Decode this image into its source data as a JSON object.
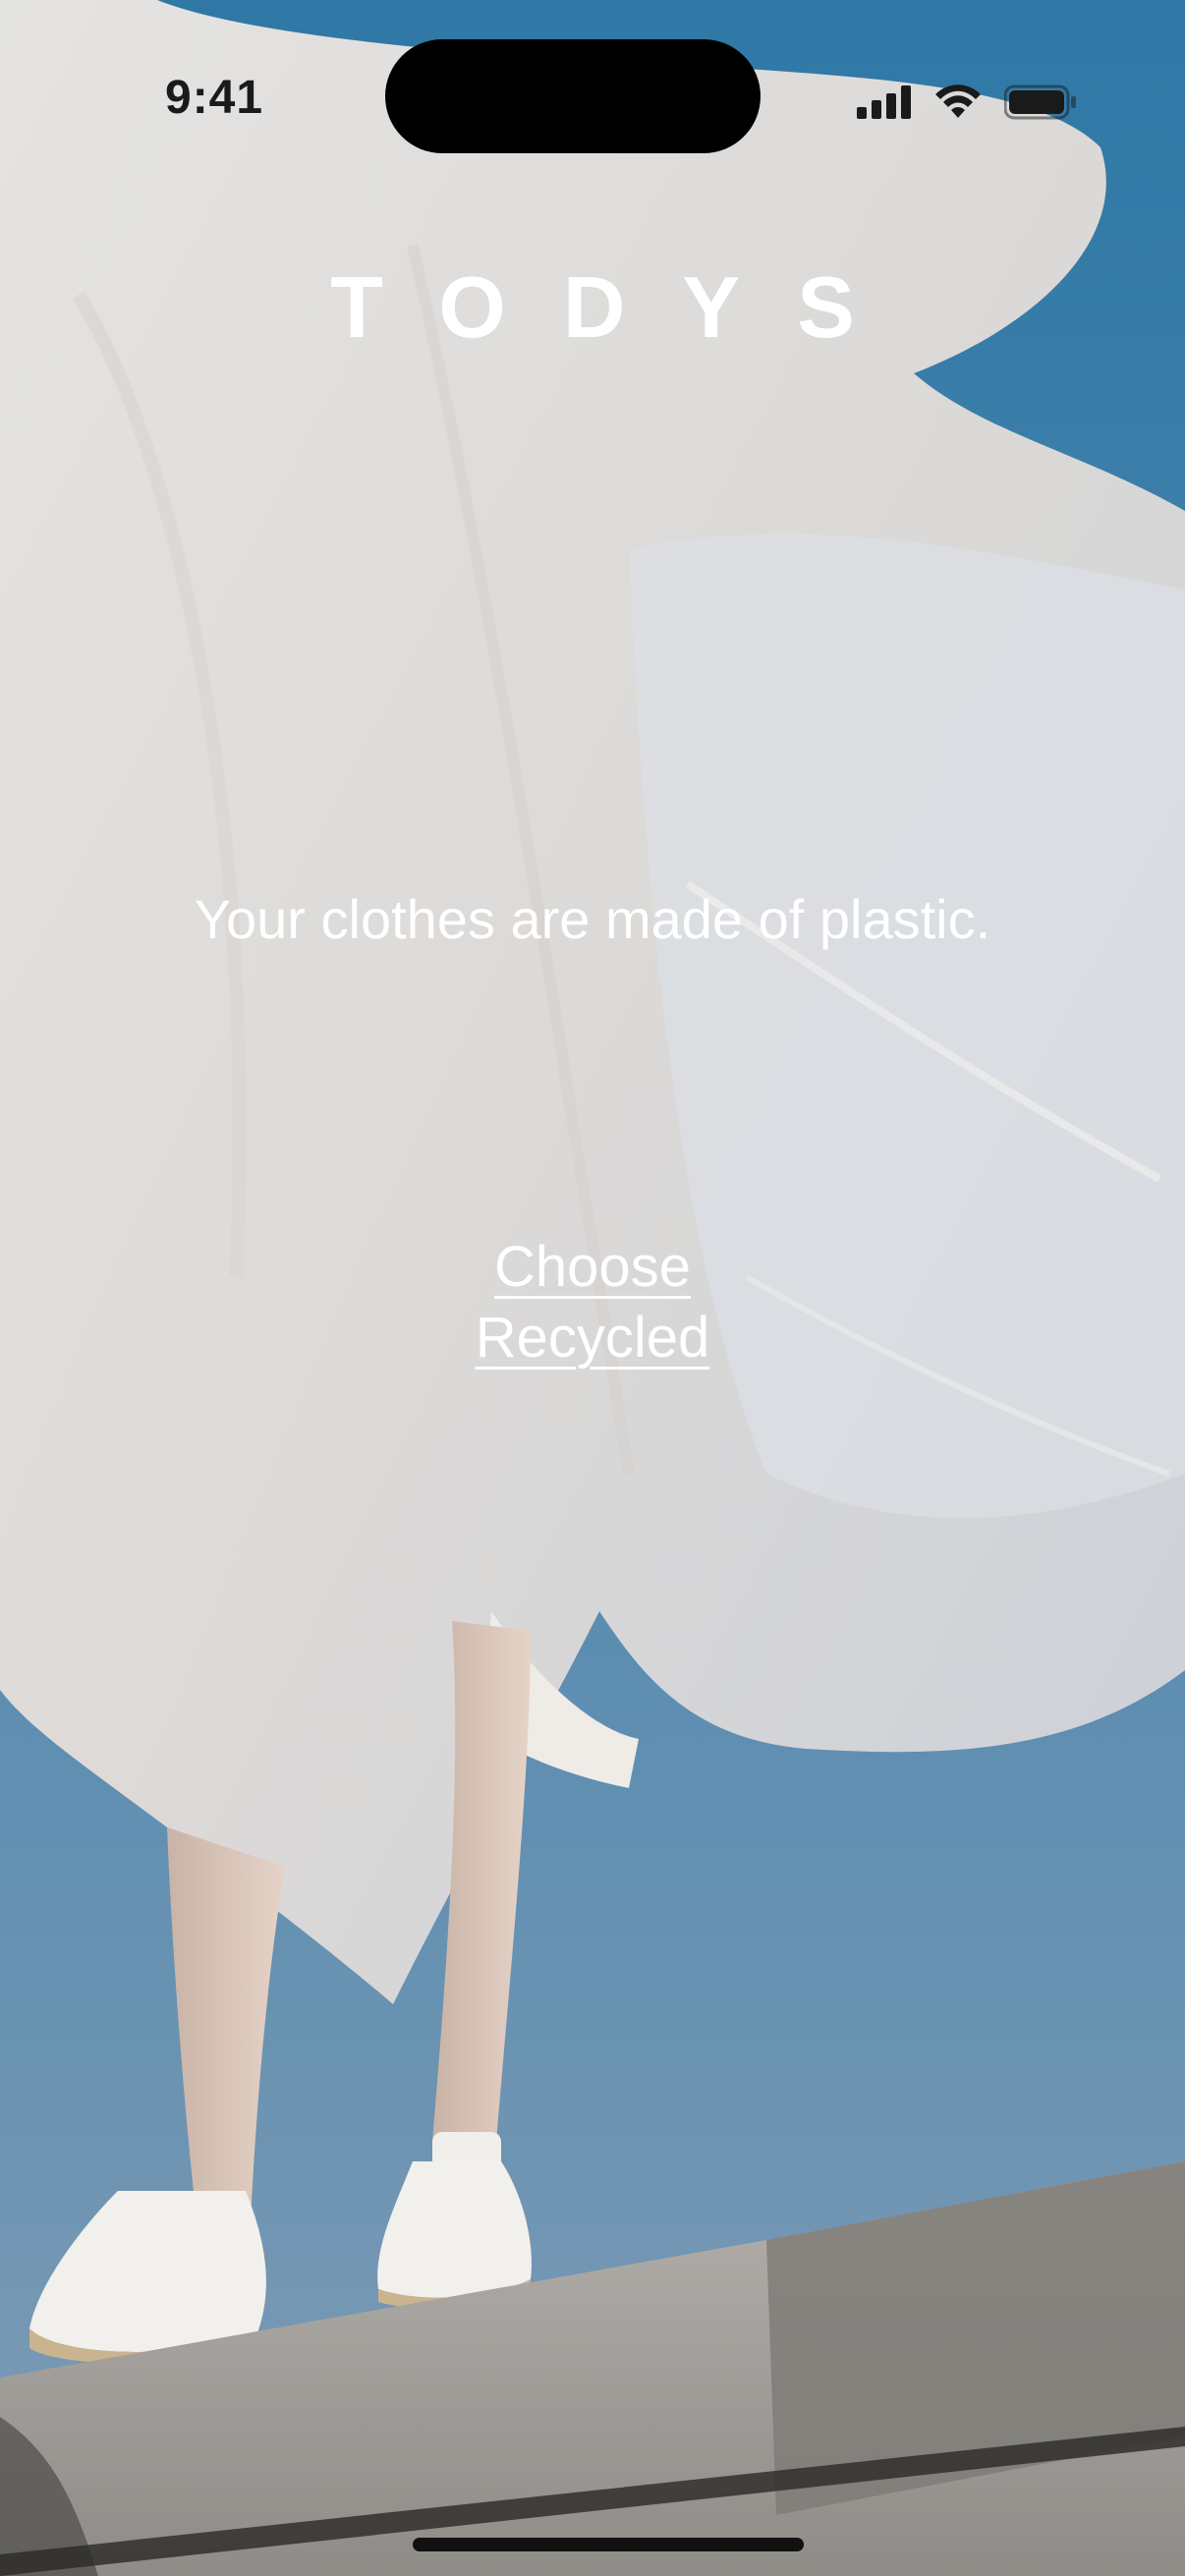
{
  "status_bar": {
    "time": "9:41",
    "icons": [
      "cellular-signal-icon",
      "wifi-icon",
      "battery-icon"
    ]
  },
  "background": {
    "icon": "model-in-plastic-sheet-photo",
    "colors": {
      "sky": "#3d7ea6",
      "plastic": "#e6e1dc",
      "stone": "#9a9894"
    }
  },
  "brand": {
    "name": "TODYS"
  },
  "hero": {
    "headline": "Your clothes are made of plastic."
  },
  "cta": {
    "line1": "Choose",
    "line2": "Recycled"
  }
}
